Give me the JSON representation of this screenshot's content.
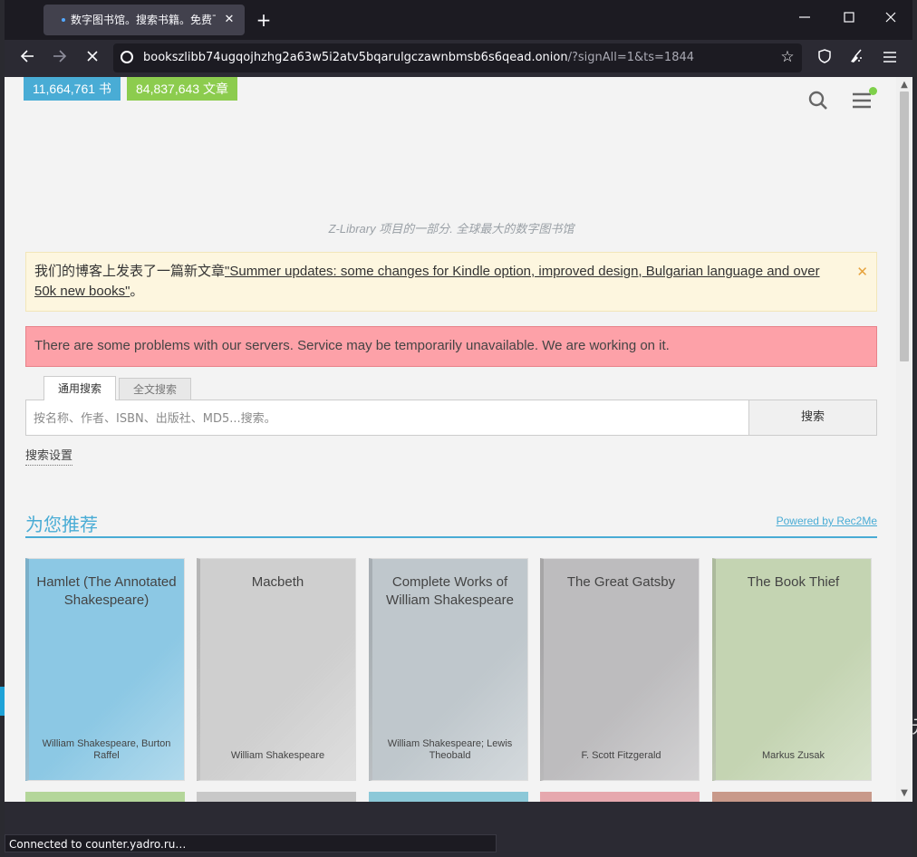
{
  "browser": {
    "tab_title": "数字图书馆。搜索书籍。免费下载书籍",
    "tab_close": "✕",
    "new_tab": "+",
    "url_host": "bookszlibb74ugqojhzhg2a63w5i2atv5bqarulgczawnbmsb6s6qead.onion",
    "url_rest": "/?signAll=1&ts=1844",
    "status": "Connected to counter.yadro.ru…"
  },
  "page": {
    "books_count": "11,664,761 书",
    "articles_count": "84,837,643 文章",
    "tagline": "Z-Library 项目的一部分. 全球最大的数字图书馆",
    "notice_prefix": "我们的博客上发表了一篇新文章",
    "notice_link": "\"Summer updates: some changes for Kindle option, improved design, Bulgarian language and over 50k new books\"",
    "notice_suffix": "。",
    "alert": "There are some problems with our servers. Service may be temporarily unavailable. We are working on it.",
    "tab_general": "通用搜索",
    "tab_fulltext": "全文搜索",
    "search_placeholder": "按名称、作者、ISBN、出版社、MD5...搜索。",
    "search_button": "搜索",
    "search_settings": "搜索设置",
    "recommend_title": "为您推荐",
    "powered_by": "Powered by Rec2Me"
  },
  "books": [
    {
      "title": "Hamlet (The Annotated Shakespeare)",
      "author": "William Shakespeare, Burton Raffel",
      "color": "#8cc8e4"
    },
    {
      "title": "Macbeth",
      "author": "William Shakespeare",
      "color": "#cfcfcf"
    },
    {
      "title": "Complete Works of William Shakespeare",
      "author": "William Shakespeare; Lewis Theobald",
      "color": "#bfc7cc"
    },
    {
      "title": "The Great Gatsby",
      "author": "F. Scott Fitzgerald",
      "color": "#bdbcbe"
    },
    {
      "title": "The Book Thief",
      "author": "Markus Zusak",
      "color": "#c4d4b2"
    }
  ],
  "books_row2_colors": [
    "#b4d69a",
    "#c8c8c8",
    "#8cc8d8",
    "#e6a8ae",
    "#c8998a"
  ],
  "icons": {
    "back": "back-arrow-icon",
    "forward": "forward-arrow-icon",
    "stop": "stop-loading-icon",
    "star": "bookmark-star-icon",
    "shield": "shield-icon",
    "extensions": "broom-icon",
    "menu": "hamburger-menu-icon"
  }
}
